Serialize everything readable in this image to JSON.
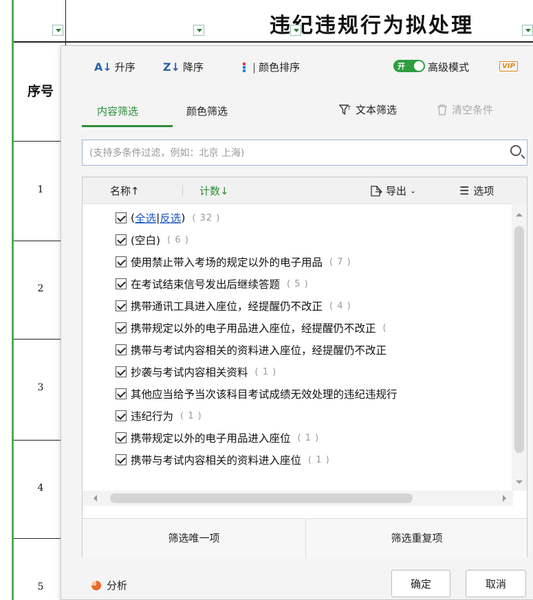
{
  "sheet": {
    "title": "违纪违规行为拟处理",
    "column_header": "序号",
    "row_numbers": [
      "1",
      "2",
      "3",
      "4",
      "5"
    ]
  },
  "popup": {
    "sort": {
      "ascending": "升序",
      "descending": "降序",
      "color_sort": "颜色排序"
    },
    "advanced": {
      "toggle_text": "开",
      "label": "高级模式",
      "vip_badge": "VIP"
    },
    "tabs": {
      "content_filter": "内容筛选",
      "color_filter": "颜色筛选"
    },
    "text_filter": "文本筛选",
    "clear_conditions": "清空条件",
    "search": {
      "placeholder": "(支持多条件过滤，例如：北京 上海)"
    },
    "list_header": {
      "name": "名称↑",
      "count": "计数↓",
      "export": "导出",
      "options": "选项"
    },
    "items": [
      {
        "label": "(",
        "select_all": "全选",
        "sep": "|",
        "invert": "反选",
        "close": ")",
        "count": "( 32 )"
      },
      {
        "label": "(空白)",
        "count": "( 6 )"
      },
      {
        "label": "使用禁止带入考场的规定以外的电子用品",
        "count": "( 7 )"
      },
      {
        "label": "在考试结束信号发出后继续答题",
        "count": "( 5 )"
      },
      {
        "label": "携带通讯工具进入座位，经提醒仍不改正",
        "count": "( 4 )"
      },
      {
        "label": "携带规定以外的电子用品进入座位，经提醒仍不改正",
        "count": "("
      },
      {
        "label": "携带与考试内容相关的资料进入座位，经提醒仍不改正",
        "count": ""
      },
      {
        "label": "抄袭与考试内容相关资料",
        "count": "( 1 )"
      },
      {
        "label": "其他应当给予当次该科目考试成绩无效处理的违纪违规行",
        "count": ""
      },
      {
        "label": "违纪行为",
        "count": "( 1 )"
      },
      {
        "label": "携带规定以外的电子用品进入座位",
        "count": "( 1 )"
      },
      {
        "label": "携带与考试内容相关的资料进入座位",
        "count": "( 1 )"
      }
    ],
    "bottom": {
      "unique": "筛选唯一项",
      "duplicate": "筛选重复项"
    },
    "analysis": "分析",
    "ok": "确定",
    "cancel": "取消"
  },
  "colors": {
    "accent_green": "#2e8b3a",
    "link_blue": "#1a56c4",
    "vip_orange": "#e08a1a"
  }
}
